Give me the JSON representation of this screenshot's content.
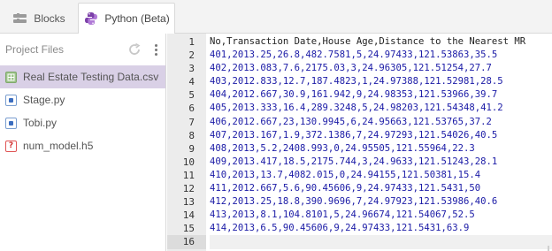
{
  "tabs": [
    {
      "label": "Blocks",
      "icon": "blocks-icon"
    },
    {
      "label": "Python (Beta)",
      "icon": "python-logo-icon"
    }
  ],
  "sidebar": {
    "title": "Project Files",
    "files": [
      {
        "name": "Real Estate Testing Data.csv",
        "icon": "csv-file-icon",
        "selected": true
      },
      {
        "name": "Stage.py",
        "icon": "python-file-icon"
      },
      {
        "name": "Tobi.py",
        "icon": "python-file-icon"
      },
      {
        "name": "num_model.h5",
        "icon": "unknown-file-icon"
      }
    ]
  },
  "editor": {
    "lines": [
      {
        "num": "1",
        "text": "No,Transaction Date,House Age,Distance to the Nearest MR"
      },
      {
        "num": "2",
        "text": "401,2013.25,26.8,482.7581,5,24.97433,121.53863,35.5"
      },
      {
        "num": "3",
        "text": "402,2013.083,7.6,2175.03,3,24.96305,121.51254,27.7"
      },
      {
        "num": "4",
        "text": "403,2012.833,12.7,187.4823,1,24.97388,121.52981,28.5"
      },
      {
        "num": "5",
        "text": "404,2012.667,30.9,161.942,9,24.98353,121.53966,39.7"
      },
      {
        "num": "6",
        "text": "405,2013.333,16.4,289.3248,5,24.98203,121.54348,41.2"
      },
      {
        "num": "7",
        "text": "406,2012.667,23,130.9945,6,24.95663,121.53765,37.2"
      },
      {
        "num": "8",
        "text": "407,2013.167,1.9,372.1386,7,24.97293,121.54026,40.5"
      },
      {
        "num": "9",
        "text": "408,2013,5.2,2408.993,0,24.95505,121.55964,22.3"
      },
      {
        "num": "10",
        "text": "409,2013.417,18.5,2175.744,3,24.9633,121.51243,28.1"
      },
      {
        "num": "11",
        "text": "410,2013,13.7,4082.015,0,24.94155,121.50381,15.4"
      },
      {
        "num": "12",
        "text": "411,2012.667,5.6,90.45606,9,24.97433,121.5431,50"
      },
      {
        "num": "13",
        "text": "412,2013.25,18.8,390.9696,7,24.97923,121.53986,40.6"
      },
      {
        "num": "14",
        "text": "413,2013,8.1,104.8101,5,24.96674,121.54067,52.5"
      },
      {
        "num": "15",
        "text": "414,2013,6.5,90.45606,9,24.97433,121.5431,63.9"
      },
      {
        "num": "16",
        "text": ""
      }
    ]
  },
  "colors": {
    "selected_file_bg": "#d9d0e6",
    "data_text": "#1a1aa6",
    "gutter_bg": "#ececec"
  }
}
